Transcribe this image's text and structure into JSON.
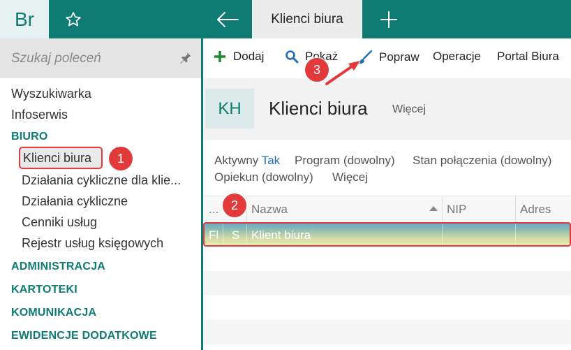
{
  "topbar": {
    "logo_text": "Br",
    "favorites_icon": "star-icon",
    "back_icon": "arrow-left-icon",
    "active_tab": "Klienci biura",
    "new_tab_icon": "plus-icon"
  },
  "sidebar": {
    "search_placeholder": "Szukaj poleceń",
    "pin_icon": "pin-icon",
    "items": [
      {
        "label": "Wyszukiwarka"
      },
      {
        "label": "Infoserwis"
      }
    ],
    "sections": [
      {
        "label": "BIURO"
      },
      {
        "label": "ADMINISTRACJA"
      },
      {
        "label": "KARTOTEKI"
      },
      {
        "label": "KOMUNIKACJA"
      },
      {
        "label": "EWIDENCJE DODATKOWE"
      }
    ],
    "biuro_items": [
      {
        "label": "Klienci biura"
      },
      {
        "label": "Działania cykliczne dla klie..."
      },
      {
        "label": "Działania cykliczne"
      },
      {
        "label": "Cenniki usług"
      },
      {
        "label": "Rejestr usług księgowych"
      }
    ]
  },
  "callouts": [
    "1",
    "2",
    "3"
  ],
  "toolbar": {
    "add": "Dodaj",
    "show": "Pokaż",
    "edit": "Popraw",
    "operations": "Operacje",
    "portal": "Portal Biura"
  },
  "header": {
    "badge": "KH",
    "title": "Klienci biura",
    "more": "Więcej"
  },
  "filters": {
    "active_label": "Aktywny",
    "active_value": "Tak",
    "program": "Program (dowolny)",
    "connection": "Stan połączenia (dowolny)",
    "caretaker": "Opiekun (dowolny)",
    "more": "Więcej"
  },
  "grid": {
    "columns": [
      "...",
      "Nazwa",
      "NIP",
      "Adres"
    ],
    "rows": [
      {
        "col1": "Fl",
        "col2": "S",
        "name": "Klient biura",
        "nip": "",
        "address": ""
      }
    ]
  },
  "colors": {
    "brand": "#0e7c73",
    "callout": "#e23a3a",
    "link": "#1f6fb5"
  }
}
